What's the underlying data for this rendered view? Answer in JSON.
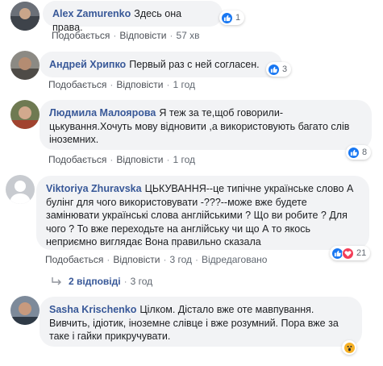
{
  "actions": {
    "like": "Подобається",
    "reply": "Відповісти",
    "edited": "Відредаговано"
  },
  "comments": [
    {
      "author": "Alex Zamurenko",
      "text": "Здесь она права.",
      "time": "57 хв",
      "reaction_count": "1",
      "reactions": [
        "like"
      ]
    },
    {
      "author": "Андрей Хрипко",
      "text": "Первый раз с ней согласен.",
      "time": "1 год",
      "reaction_count": "3",
      "reactions": [
        "like"
      ]
    },
    {
      "author": "Людмила Малоярова",
      "text": "Я теж за те,щоб говорили-цькування.Хочуть мову відновити ,а використовують багато слів іноземних.",
      "time": "1 год",
      "reaction_count": "8",
      "reactions": [
        "like"
      ]
    },
    {
      "author": "Viktoriya Zhuravska",
      "text": "ЦЬКУВАННЯ--це типічне українське слово А булінг для чого використовувати -???--може вже будете замінювати українські слова англійськими ? Що ви робите ? Для чого ? То вже переходьте на англійську чи що А то якось неприємно виглядає Вона правильно сказала",
      "time": "3 год",
      "reaction_count": "21",
      "reactions": [
        "like",
        "love"
      ]
    },
    {
      "author": "Sasha Krischenko",
      "text": "Цілком. Дістало вже оте мавпування. Вивчить, ідіотик, іноземне слівце і вже розумний. Пора вже за таке і гайки прикручувати.",
      "reactions": [
        "wow"
      ]
    }
  ],
  "replies_thread": {
    "label": "2 відповіді",
    "time": "3 год"
  }
}
